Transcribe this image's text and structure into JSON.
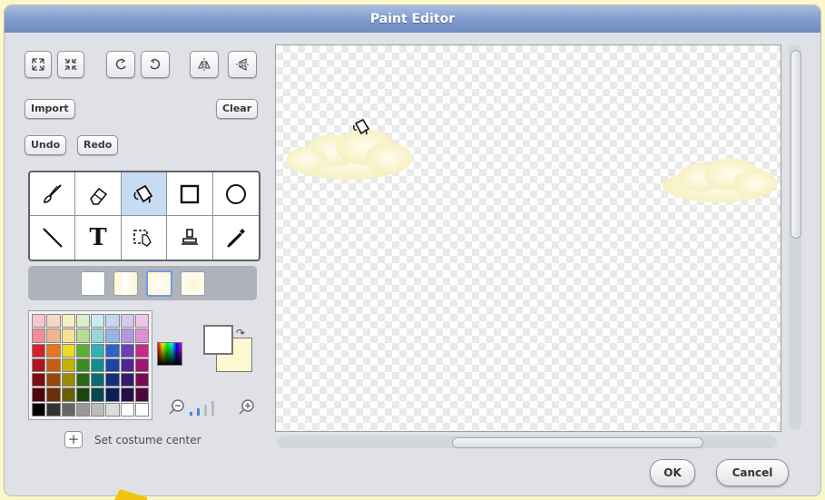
{
  "window": {
    "title": "Paint Editor"
  },
  "top_tools": [
    {
      "name": "grow-icon"
    },
    {
      "name": "shrink-icon"
    },
    {
      "name": "rotate-left-icon"
    },
    {
      "name": "rotate-right-icon"
    },
    {
      "name": "flip-horizontal-icon"
    },
    {
      "name": "flip-vertical-icon"
    }
  ],
  "buttons": {
    "import": "Import",
    "clear": "Clear",
    "undo": "Undo",
    "redo": "Redo",
    "ok": "OK",
    "cancel": "Cancel"
  },
  "tools": [
    {
      "name": "paintbrush-icon",
      "active": false
    },
    {
      "name": "eraser-icon",
      "active": false
    },
    {
      "name": "fill-bucket-icon",
      "active": true
    },
    {
      "name": "rectangle-icon",
      "active": false
    },
    {
      "name": "ellipse-icon",
      "active": false
    },
    {
      "name": "line-icon",
      "active": false
    },
    {
      "name": "text-icon",
      "active": false,
      "glyph": "T"
    },
    {
      "name": "select-icon",
      "active": false
    },
    {
      "name": "stamp-icon",
      "active": false
    },
    {
      "name": "eyedropper-icon",
      "active": false
    }
  ],
  "fill_options": [
    "solid",
    "horizontal-gradient",
    "radial-gradient",
    "vertical-gradient"
  ],
  "palette": [
    "#f6c6cc",
    "#f6d9c4",
    "#f6eec4",
    "#dcefc8",
    "#c8ecec",
    "#c6d6f1",
    "#d5c9ee",
    "#efc6e7",
    "#ee8f97",
    "#f2b58e",
    "#f2e293",
    "#b8dc96",
    "#96d6d8",
    "#96b4e8",
    "#b099e2",
    "#e08fd2",
    "#d6202c",
    "#e8751b",
    "#eadb23",
    "#5aae32",
    "#2db2b6",
    "#2e63c8",
    "#6b3fb8",
    "#c6288e",
    "#b0141e",
    "#c95d0f",
    "#c6b300",
    "#3d8c1f",
    "#118e92",
    "#1a46a4",
    "#4e2593",
    "#a0136e",
    "#7e0a12",
    "#9a430a",
    "#998a00",
    "#2a6813",
    "#0b6b6e",
    "#12317c",
    "#371a6d",
    "#780b53",
    "#4d050a",
    "#6b2e05",
    "#6b6000",
    "#1b460b",
    "#07484a",
    "#0a1f53",
    "#23104a",
    "#4f0737",
    "#000000",
    "#333333",
    "#666666",
    "#999999",
    "#bbbbbb",
    "#dddddd",
    "#ffffff",
    "#ffffff"
  ],
  "colors": {
    "primary": "#ffffff",
    "secondary": "#fdf8d0",
    "title_bar": "#7f9acb",
    "background": "#fbf7c8"
  },
  "costume_center": {
    "label": "Set costume center"
  }
}
